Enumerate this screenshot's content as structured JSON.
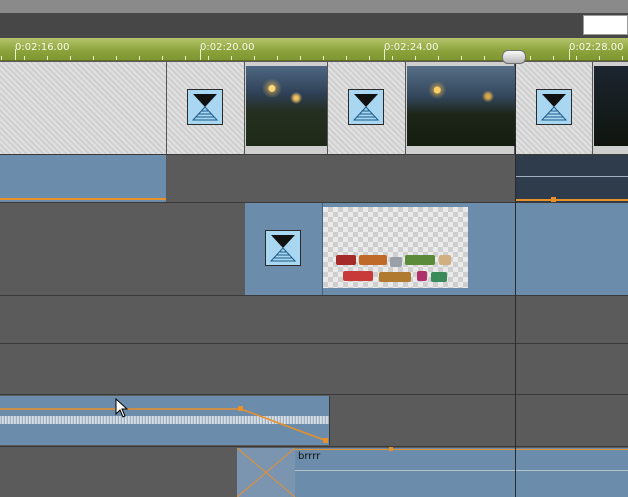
{
  "ruler": {
    "labels": [
      "0:02:16.00",
      "0:02:20.00",
      "0:02:24.00",
      "0:02:28.00"
    ]
  },
  "clips": {
    "audio_clip_label": "brrrr"
  },
  "colors": {
    "ruler": "#8ba23a",
    "clip_blue": "#6c8cab",
    "keyframe_line": "#e8902a",
    "transition": "#a9d6f0",
    "background": "#5b5b5b"
  },
  "icons": {
    "transition": "hourglass-transition-icon",
    "cursor": "mouse-pointer-icon"
  }
}
